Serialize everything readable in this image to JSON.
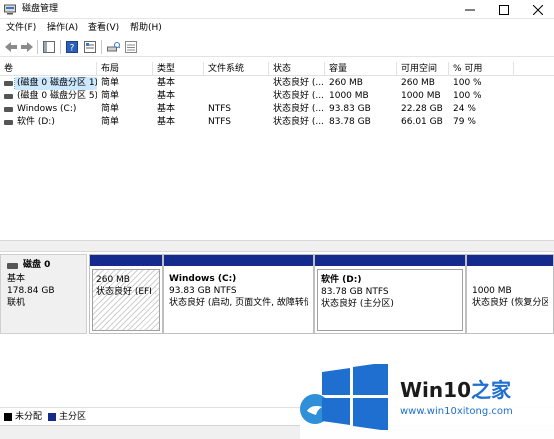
{
  "window": {
    "title": "磁盘管理",
    "buttons": [
      "minimize",
      "maximize",
      "close"
    ]
  },
  "menu": [
    "文件(F)",
    "操作(A)",
    "查看(V)",
    "帮助(H)"
  ],
  "toolbar": {
    "icons": [
      "back-arrow-icon",
      "forward-arrow-icon",
      "console-tree-icon",
      "help-icon",
      "properties-icon",
      "connect-drive-icon",
      "list-view-icon"
    ]
  },
  "list": {
    "columns": [
      "卷",
      "布局",
      "类型",
      "文件系统",
      "状态",
      "容量",
      "可用空间",
      "% 可用"
    ],
    "rows": [
      {
        "name": "(磁盘 0 磁盘分区 1)",
        "layout": "简单",
        "type": "基本",
        "fs": "",
        "status": "状态良好 (...",
        "capacity": "260 MB",
        "free": "260 MB",
        "pct": "100 %",
        "selected": true
      },
      {
        "name": "(磁盘 0 磁盘分区 5)",
        "layout": "简单",
        "type": "基本",
        "fs": "",
        "status": "状态良好 (...",
        "capacity": "1000 MB",
        "free": "1000 MB",
        "pct": "100 %",
        "selected": false
      },
      {
        "name": "Windows (C:)",
        "layout": "简单",
        "type": "基本",
        "fs": "NTFS",
        "status": "状态良好 (...",
        "capacity": "93.83 GB",
        "free": "22.28 GB",
        "pct": "24 %",
        "selected": false
      },
      {
        "name": "软件 (D:)",
        "layout": "简单",
        "type": "基本",
        "fs": "NTFS",
        "status": "状态良好 (...",
        "capacity": "83.78 GB",
        "free": "66.01 GB",
        "pct": "79 %",
        "selected": false
      }
    ]
  },
  "disk": {
    "name": "磁盘 0",
    "type": "基本",
    "size": "178.84 GB",
    "state": "联机",
    "partitions": [
      {
        "name": "",
        "line1": "260 MB",
        "line2": "状态良好 (EFI 系",
        "style": "hatched"
      },
      {
        "name": "Windows  (C:)",
        "line1": "93.83 GB NTFS",
        "line2": "状态良好 (启动, 页面文件, 故障转储",
        "style": "plain"
      },
      {
        "name": "软件  (D:)",
        "line1": "83.78 GB NTFS",
        "line2": "状态良好 (主分区)",
        "style": "outlined"
      },
      {
        "name": "",
        "line1": "1000 MB",
        "line2": "状态良好 (恢复分区",
        "style": "plain"
      }
    ]
  },
  "legend": [
    {
      "label": "未分配",
      "color": "#000000"
    },
    {
      "label": "主分区",
      "color": "#142a8c"
    }
  ],
  "watermark": {
    "brand_main": "Win10",
    "brand_accent": "之家",
    "url": "www.win10xitong.com"
  }
}
